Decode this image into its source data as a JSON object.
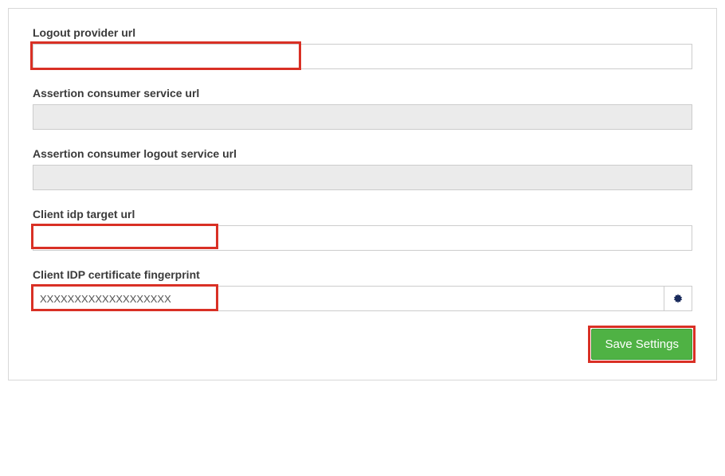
{
  "fields": {
    "logout_provider": {
      "label": "Logout provider url",
      "value": ""
    },
    "acs_url": {
      "label": "Assertion consumer service url",
      "value": ""
    },
    "acs_logout_url": {
      "label": "Assertion consumer logout service url",
      "value": ""
    },
    "client_idp_target": {
      "label": "Client idp target url",
      "value": ""
    },
    "client_idp_cert": {
      "label": "Client IDP certificate fingerprint",
      "value": "XXXXXXXXXXXXXXXXXXX"
    }
  },
  "actions": {
    "save_label": "Save Settings"
  }
}
